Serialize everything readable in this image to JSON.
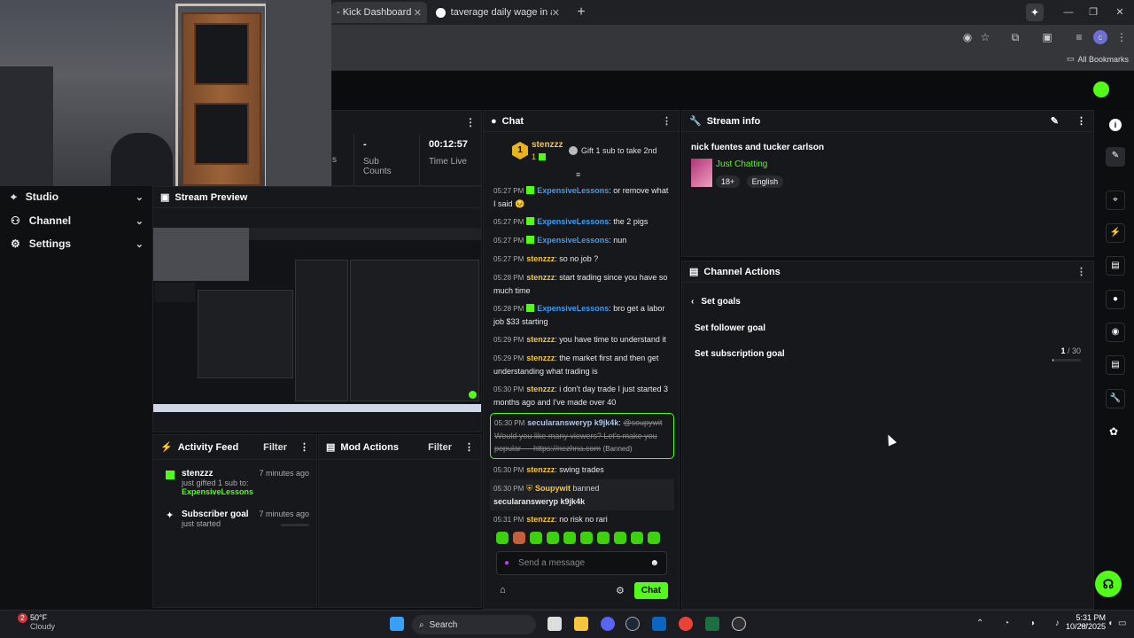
{
  "browser": {
    "tabs": [
      {
        "label": "- Kick Dashboard"
      },
      {
        "label": "taverage daily wage in africa - G"
      }
    ],
    "new_tab": "+",
    "bookmarks_label": "All Bookmarks"
  },
  "sidebar": {
    "items": [
      {
        "label": "Studio"
      },
      {
        "label": "Channel"
      },
      {
        "label": "Settings"
      }
    ]
  },
  "stats": [
    {
      "value": "",
      "label": "s"
    },
    {
      "value": "-",
      "label": "Sub Counts"
    },
    {
      "value": "00:12:57",
      "label": "Time Live"
    }
  ],
  "preview": {
    "title": "Stream Preview"
  },
  "activity": {
    "title": "Activity Feed",
    "filter": "Filter",
    "items": [
      {
        "name": "stenzzz",
        "line1": "just gifted 1 sub to:",
        "line2": "ExpensiveLessons",
        "time": "7 minutes ago"
      },
      {
        "name": "Subscriber goal",
        "line1": "just started",
        "time": "7 minutes ago"
      }
    ]
  },
  "mod_actions": {
    "title": "Mod Actions",
    "filter": "Filter"
  },
  "chat": {
    "title": "Chat",
    "pinned": {
      "rank": "1",
      "user": "stenzzz",
      "count": "1",
      "cta": "Gift 1 sub to take 2nd"
    },
    "messages": [
      {
        "time": "05:27 PM",
        "user": "ExpensiveLessons",
        "color": "blue",
        "badge": true,
        "text": ": or remove what I said 😣"
      },
      {
        "time": "05:27 PM",
        "user": "ExpensiveLessons",
        "color": "blue",
        "badge": true,
        "text": ": the 2 pigs"
      },
      {
        "time": "05:27 PM",
        "user": "ExpensiveLessons",
        "color": "blue",
        "badge": true,
        "text": ": nun"
      },
      {
        "time": "05:27 PM",
        "user": "stenzzz",
        "color": "gold",
        "badge": false,
        "text": ": so no job ?"
      },
      {
        "time": "05:28 PM",
        "user": "stenzzz",
        "color": "gold",
        "badge": false,
        "text": ": start trading since you have so much time"
      },
      {
        "time": "05:28 PM",
        "user": "ExpensiveLessons",
        "color": "blue",
        "badge": true,
        "text": ": bro get a labor job $33 starting"
      },
      {
        "time": "05:29 PM",
        "user": "stenzzz",
        "color": "gold",
        "badge": false,
        "text": ": you have time to understand it"
      },
      {
        "time": "05:29 PM",
        "user": "stenzzz",
        "color": "gold",
        "badge": false,
        "text": ": the market first and then get understanding what trading is"
      },
      {
        "time": "05:30 PM",
        "user": "stenzzz",
        "color": "gold",
        "badge": false,
        "text": ": i don't day trade I just started 3 months ago and I've made over 40"
      }
    ],
    "banned": {
      "time": "05:30 PM",
      "user": "secularansweryp k9jk4k",
      "mention": "@soupywit",
      "text": "Would you like many viewers? Let's make you popular --- https://nezhna.com",
      "tag": "(Banned)"
    },
    "after": [
      {
        "time": "05:30 PM",
        "user": "stenzzz",
        "text": ": swing trades"
      }
    ],
    "mod_event": {
      "time": "05:30 PM",
      "mod": "Soupywit",
      "action": "banned",
      "target": "secularansweryp k9jk4k"
    },
    "last": {
      "time": "05:31 PM",
      "user": "stenzzz",
      "text": ": no risk no rari"
    },
    "placeholder": "Send a message",
    "send": "Chat"
  },
  "stream_info": {
    "title": "Stream info",
    "stream_title": "nick fuentes and tucker carlson",
    "category": "Just Chatting",
    "tags": [
      "18+",
      "English"
    ]
  },
  "channel_actions": {
    "title": "Channel Actions",
    "back": "Set goals",
    "follower_goal": "Set follower goal",
    "sub_goal": "Set subscription goal",
    "sub_progress_current": "1",
    "sub_progress_total": "/ 30"
  },
  "taskbar": {
    "weather_temp": "50°F",
    "weather_desc": "Cloudy",
    "weather_badge": "2",
    "search": "Search",
    "time": "5:31 PM",
    "date": "10/28/2025"
  },
  "colors": {
    "accent": "#53fc18",
    "blue_user": "#3b9cf5",
    "gold_user": "#f5c542"
  }
}
